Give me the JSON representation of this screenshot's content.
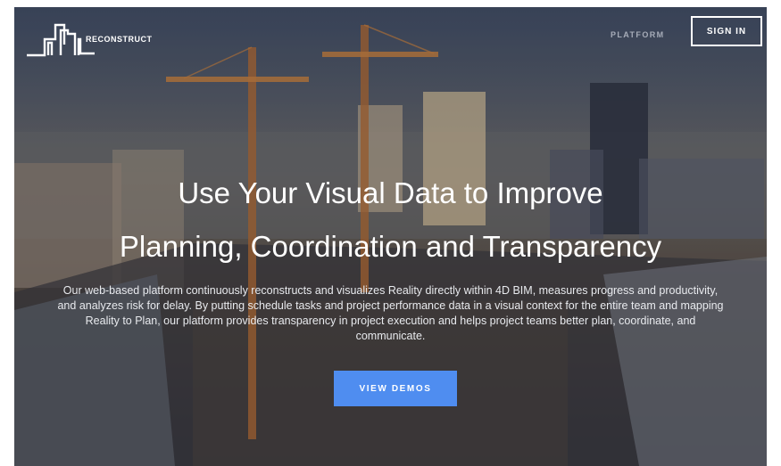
{
  "header": {
    "logo_text": "RECONSTRUCT",
    "nav_platform": "PLATFORM",
    "signin_label": "SIGN IN"
  },
  "hero": {
    "headline_line1": "Use Your Visual Data to Improve",
    "headline_line2": "Planning, Coordination and Transparency",
    "description": "Our web-based platform continuously reconstructs and visualizes Reality directly within 4D BIM, measures progress and productivity, and analyzes risk for delay. By putting schedule tasks and project performance data in a visual context for the entire team and mapping Reality to Plan, our platform provides transparency in project execution and helps project teams better plan, coordinate, and communicate.",
    "cta_label": "VIEW DEMOS"
  },
  "colors": {
    "cta_background": "#4f8df0",
    "nav_link": "#a7adb9",
    "text": "#ffffff"
  },
  "icons": {
    "logo": "reconstruct-skyline-logo-icon"
  }
}
